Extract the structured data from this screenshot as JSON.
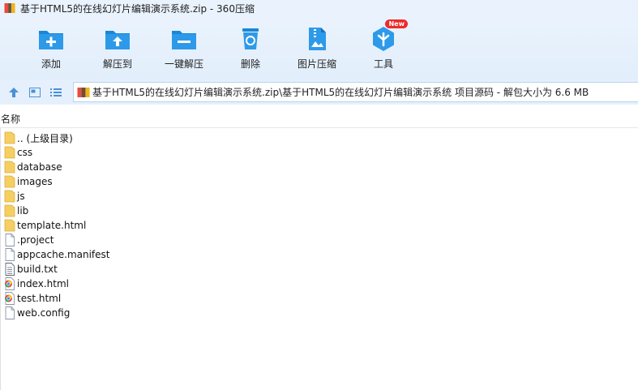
{
  "window": {
    "title": "基于HTML5的在线幻灯片编辑演示系统.zip - 360压缩"
  },
  "toolbar": {
    "items": [
      {
        "label": "添加",
        "icon": "add-folder-icon"
      },
      {
        "label": "解压到",
        "icon": "extract-to-icon"
      },
      {
        "label": "一键解压",
        "icon": "one-click-extract-icon"
      },
      {
        "label": "删除",
        "icon": "trash-icon"
      },
      {
        "label": "图片压缩",
        "icon": "image-compress-icon"
      },
      {
        "label": "工具",
        "icon": "tools-icon",
        "badge": "New"
      }
    ]
  },
  "address": {
    "path": "基于HTML5的在线幻灯片编辑演示系统.zip\\基于HTML5的在线幻灯片编辑演示系统 项目源码 - 解包大小为 6.6 MB"
  },
  "columns": {
    "name": "名称"
  },
  "files": [
    {
      "name": ".. (上级目录)",
      "type": "folder"
    },
    {
      "name": "css",
      "type": "folder"
    },
    {
      "name": "database",
      "type": "folder"
    },
    {
      "name": "images",
      "type": "folder"
    },
    {
      "name": "js",
      "type": "folder"
    },
    {
      "name": "lib",
      "type": "folder"
    },
    {
      "name": "template.html",
      "type": "folder"
    },
    {
      "name": ".project",
      "type": "file"
    },
    {
      "name": "appcache.manifest",
      "type": "file"
    },
    {
      "name": "build.txt",
      "type": "text"
    },
    {
      "name": "index.html",
      "type": "html"
    },
    {
      "name": "test.html",
      "type": "html"
    },
    {
      "name": "web.config",
      "type": "file"
    }
  ],
  "colors": {
    "accent": "#2d8ddd",
    "toolbar_bg": "#e2eefb",
    "folder": "#f5cf62",
    "badge": "#ee2b2b"
  }
}
